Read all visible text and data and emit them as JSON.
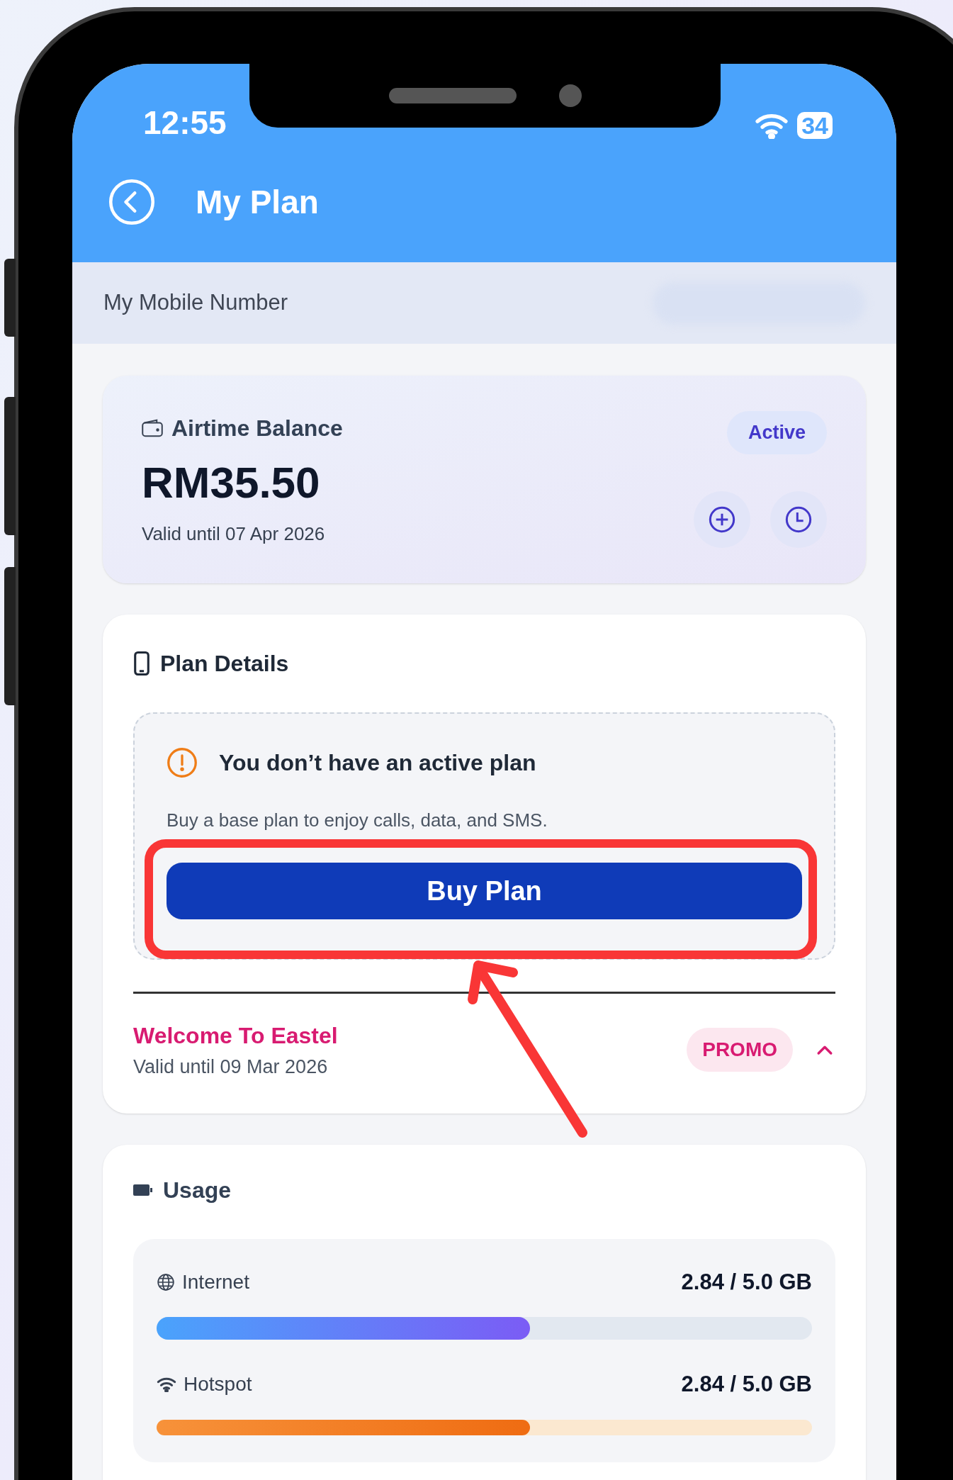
{
  "status_bar": {
    "time": "12:55",
    "battery": "34"
  },
  "header": {
    "title": "My Plan"
  },
  "mobile_number": {
    "label": "My Mobile Number"
  },
  "airtime": {
    "title": "Airtime Balance",
    "status": "Active",
    "amount": "RM35.50",
    "validity": "Valid until 07 Apr 2026"
  },
  "plan_details": {
    "title": "Plan Details",
    "notice": {
      "title": "You don’t have an active plan",
      "message": "Buy a base plan to enjoy calls, data, and SMS.",
      "button": "Buy Plan"
    },
    "promo": {
      "name": "Welcome To Eastel",
      "validity": "Valid until 09 Mar 2026",
      "badge": "PROMO",
      "expanded": true
    }
  },
  "usage": {
    "title": "Usage",
    "items": [
      {
        "kind": "internet",
        "label": "Internet",
        "reading": "2.84 / 5.0 GB",
        "level": 0.57
      },
      {
        "kind": "hotspot",
        "label": "Hotspot",
        "reading": "2.84 / 5.0 GB",
        "level": 0.57
      }
    ]
  }
}
